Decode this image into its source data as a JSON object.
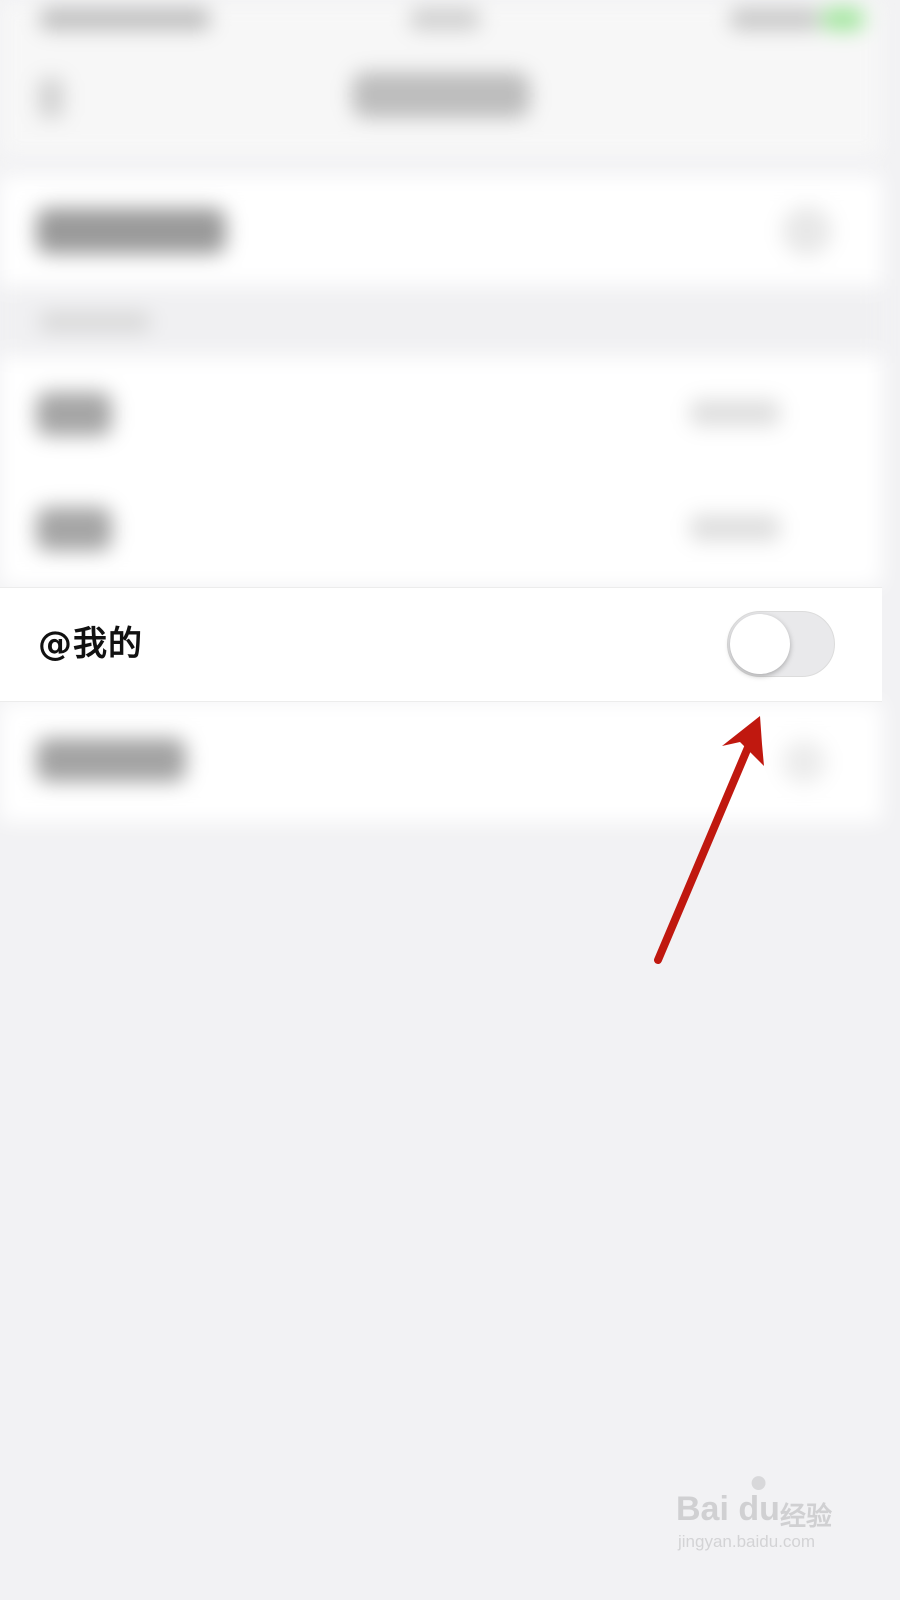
{
  "settings_row": {
    "label": "@我的",
    "toggle_on": false
  },
  "annotation": {
    "arrow_color": "#c0180f",
    "points_to": "toggle-switch"
  },
  "watermark": {
    "brand": "Bai  du",
    "product": "经验",
    "url": "jingyan.baidu.com",
    "icon": "paw-icon"
  },
  "colors": {
    "page_background": "#f2f2f4",
    "row_background": "#ffffff",
    "toggle_off_track": "#e9e9eb"
  }
}
